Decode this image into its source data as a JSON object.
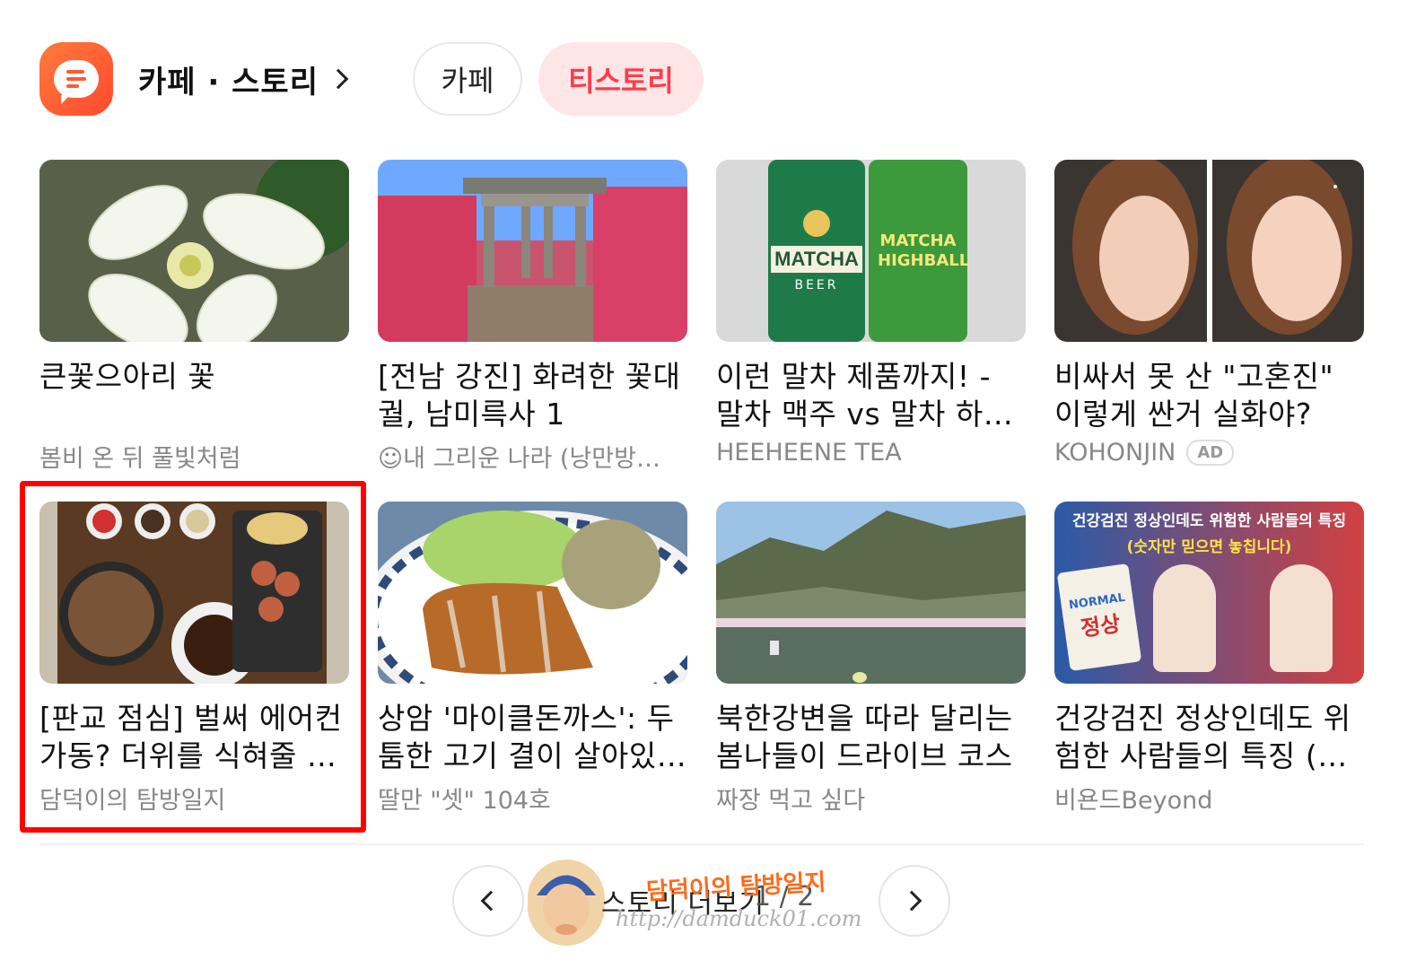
{
  "header": {
    "title": "카페 · 스토리",
    "tabs": [
      {
        "label": "카페",
        "active": false
      },
      {
        "label": "티스토리",
        "active": true
      }
    ]
  },
  "cards": [
    {
      "title": "큰꽃으아리 꽃",
      "source": "봄비 온 뒤 풀빛처럼",
      "image": "white flower"
    },
    {
      "title": "[전남 강진] 화려한 꽃대궐, 남미륵사 1",
      "source": "☺내 그리운 나라 (낭만방…",
      "image": "temple gate with azaleas"
    },
    {
      "title": "이런 말차 제품까지! - 말차 맥주 vs 말차 하…",
      "source": "HEEHEENE TEA",
      "image": "matcha cans"
    },
    {
      "title": "비싸서 못 산 \"고혼진\" 이렇게 싼거 실화야?",
      "source": "KOHONJIN",
      "ad": "AD",
      "image": "woman faces"
    },
    {
      "title": "[판교 점심] 벌써 에어컨 가동? 더위를 식혀줄 …",
      "source": "담덕이의 탐방일지",
      "highlighted": true,
      "image": "soba and katsu"
    },
    {
      "title": "상암 '마이클돈까스': 두툼한 고기 결이 살아있…",
      "source": "딸만 \"셋\" 104호",
      "image": "pork cutlet"
    },
    {
      "title": "북한강변을 따라 달리는 봄나들이 드라이브 코스",
      "source": "짜장 먹고 싶다",
      "image": "river and mountains"
    },
    {
      "title": "건강검진 정상인데도 위험한 사람들의 특징 (…",
      "source": "비욘드Beyond",
      "image": "health checkup illustration"
    }
  ],
  "overlay_texts": {
    "card8_heading1": "건강검진 정상인데도 위험한 사람들의 특징",
    "card8_heading2": "(숫자만 믿으면 놓칩니다)",
    "card8_normal": "NORMAL",
    "card8_normal_kr": "정상",
    "card3_matcha": "MATCHA",
    "card3_beer": "BEER",
    "card3_highball": "MATCHA HIGHBALL"
  },
  "footer": {
    "more_label": "스토리 더보기",
    "page_current": "1",
    "page_total": "2",
    "page_indicator": "1 / 2",
    "watermark_name": "담덕이의 탐방일지",
    "watermark_url": "http://damduck01.com"
  },
  "colors": {
    "accent": "#ff3b4b",
    "highlight_border": "#ff0000",
    "app_icon": "#ff5a33"
  }
}
